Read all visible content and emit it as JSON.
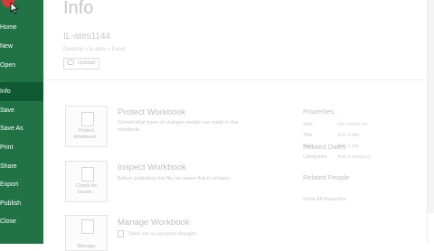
{
  "sidebar": {
    "items": [
      {
        "label": "Home",
        "active": false
      },
      {
        "label": "New",
        "active": false
      },
      {
        "label": "Open",
        "active": false
      },
      {
        "label": "Info",
        "active": true
      },
      {
        "label": "Save",
        "active": false
      },
      {
        "label": "Save As",
        "active": false
      },
      {
        "label": "Print",
        "active": false
      },
      {
        "label": "Share",
        "active": false
      },
      {
        "label": "Export",
        "active": false
      },
      {
        "label": "Publish",
        "active": false
      },
      {
        "label": "Close",
        "active": false
      }
    ],
    "background_color": "#217346",
    "active_color": "#0f5a33"
  },
  "info": {
    "title": "Info",
    "doc_name": "IL-ates1144",
    "doc_path": "Desktop » IL-ates » Excel",
    "upload_label": "Upload"
  },
  "sections": {
    "protect": {
      "card_label_1": "Protect",
      "card_label_2": "Workbook ·",
      "title": "Protect Workbook",
      "desc_1": "Control what types of changes people can make to this",
      "desc_2": "workbook."
    },
    "inspect": {
      "card_label_1": "Check for",
      "card_label_2": "Issues ·",
      "title": "Inspect Workbook",
      "desc_1": "Before publishing this file, be aware that it contains:"
    },
    "manage": {
      "card_label_1": "Manage",
      "title": "Manage Workbook",
      "desc_1": "There are no unsaved changes."
    }
  },
  "properties": {
    "title": "Properties ·",
    "rows": [
      {
        "label": "Size",
        "value": "Not saved yet"
      },
      {
        "label": "Title",
        "value": "Add a title"
      },
      {
        "label": "Tags",
        "value": "Add a tag"
      },
      {
        "label": "Categories",
        "value": "Add a category"
      }
    ],
    "related_dates": "Related Dates",
    "related_people": "Related People",
    "show_all": "Show All Properties"
  }
}
